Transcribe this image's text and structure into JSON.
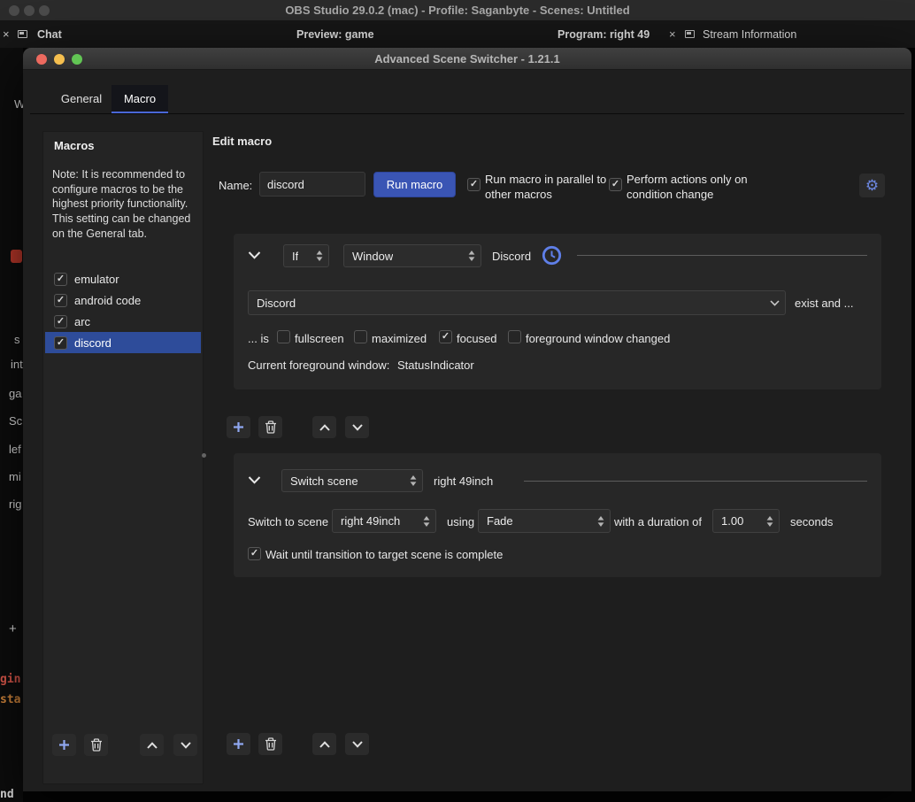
{
  "macos": {
    "title": "OBS Studio 29.0.2 (mac) - Profile: Saganbyte - Scenes: Untitled"
  },
  "docks": {
    "chat_close": "×",
    "chat_label": "Chat",
    "preview_label": "Preview: game",
    "program_label": "Program: right 49",
    "stream_close": "×",
    "stream_label": "Stream Information"
  },
  "background": {
    "frag_w": "W",
    "frag_s": "s",
    "frag_int": "int",
    "frag_ga": "ga",
    "frag_sc": "Sc",
    "frag_lef": "lef",
    "frag_mi": "mi",
    "frag_rig": "rig",
    "frag_plus": "+",
    "frag_gin": "gin",
    "frag_sta": "sta",
    "frag_nd": "nd"
  },
  "dialog": {
    "title": "Advanced Scene Switcher - 1.21.1",
    "tabs": {
      "general": "General",
      "macro": "Macro"
    },
    "macros_panel": {
      "title": "Macros",
      "note1": "Note: It is recommended to configure macros to be the highest priority functionality.",
      "note2": "This setting can be changed on the General tab.",
      "items": [
        {
          "label": "emulator",
          "check": "✓"
        },
        {
          "label": "android code",
          "check": "✓"
        },
        {
          "label": "arc",
          "check": "✓"
        },
        {
          "label": "discord",
          "check": "✓"
        }
      ]
    },
    "edit": {
      "title": "Edit macro",
      "name_label": "Name:",
      "name_value": "discord",
      "run_button": "Run macro",
      "parallel_check": "✓",
      "parallel_line1": "Run macro in parallel to",
      "parallel_line2": "other macros",
      "cond_change_check": "✓",
      "cond_change_line1": "Perform actions only on",
      "cond_change_line2": "condition change"
    },
    "condition": {
      "if_value": "If",
      "type_value": "Window",
      "summary": "Discord",
      "window_value": "Discord",
      "exist_text": "exist and ...",
      "is_label": "... is",
      "checks": [
        {
          "label": "fullscreen",
          "check": ""
        },
        {
          "label": "maximized",
          "check": ""
        },
        {
          "label": "focused",
          "check": "✓"
        },
        {
          "label": "foreground window changed",
          "check": ""
        }
      ],
      "current_label": "Current foreground window:",
      "current_value": "StatusIndicator"
    },
    "action": {
      "type_value": "Switch scene",
      "summary": "right 49inch",
      "switch_label": "Switch to scene",
      "scene_value": "right 49inch",
      "using_label": "using",
      "transition_value": "Fade",
      "duration_label": "with a duration of",
      "duration_value": "1.00",
      "seconds_label": "seconds",
      "wait_check": "✓",
      "wait_label": "Wait until transition to target scene is complete"
    }
  }
}
